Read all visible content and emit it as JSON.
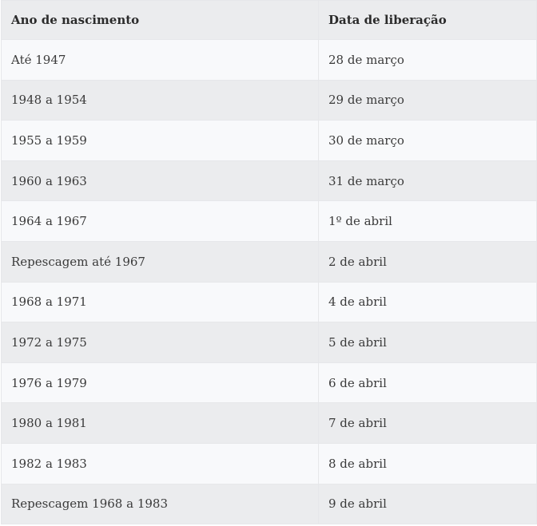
{
  "table": {
    "headers": [
      "Ano de nascimento",
      "Data de liberação"
    ],
    "rows": [
      [
        "Até 1947",
        "28 de março"
      ],
      [
        "1948 a 1954",
        "29 de março"
      ],
      [
        "1955 a 1959",
        "30 de março"
      ],
      [
        "1960 a 1963",
        "31 de março"
      ],
      [
        "1964 a 1967",
        "1º de abril"
      ],
      [
        "Repescagem até 1967",
        "2 de abril"
      ],
      [
        "1968 a 1971",
        "4 de abril"
      ],
      [
        "1972 a 1975",
        "5 de abril"
      ],
      [
        "1976 a 1979",
        "6 de abril"
      ],
      [
        "1980 a 1981",
        "7 de abril"
      ],
      [
        "1982 a 1983",
        "8 de abril"
      ],
      [
        "Repescagem 1968 a 1983",
        "9 de abril"
      ]
    ]
  }
}
